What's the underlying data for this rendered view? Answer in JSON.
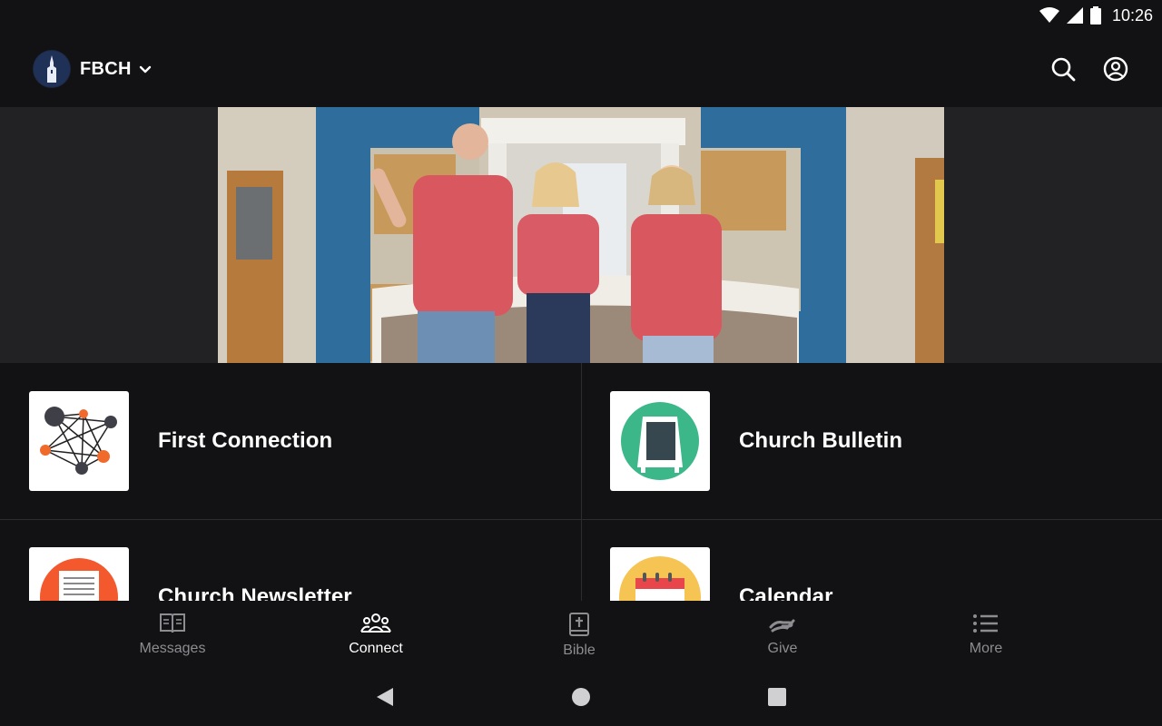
{
  "status_bar": {
    "time": "10:26",
    "icons": [
      "wifi-icon",
      "signal-icon",
      "battery-icon"
    ]
  },
  "app_bar": {
    "title": "FBCH",
    "icons": {
      "logo": "church-steeple-logo",
      "dropdown": "chevron-down-icon",
      "search": "search-icon",
      "profile": "account-circle-icon"
    }
  },
  "hero": {
    "description_icon": "welcome-photo"
  },
  "tiles": [
    {
      "label": "First Connection",
      "icon": "network-graph-icon"
    },
    {
      "label": "Church Bulletin",
      "icon": "bulletin-board-icon"
    },
    {
      "label": "Church Newsletter",
      "icon": "newsletter-icon"
    },
    {
      "label": "Calendar",
      "icon": "calendar-icon"
    }
  ],
  "bottom_nav": {
    "items": [
      {
        "label": "Messages",
        "icon": "open-book-icon"
      },
      {
        "label": "Connect",
        "icon": "people-group-icon"
      },
      {
        "label": "Bible",
        "icon": "bible-icon"
      },
      {
        "label": "Give",
        "icon": "giving-hand-icon"
      },
      {
        "label": "More",
        "icon": "list-icon"
      }
    ],
    "active": "Connect"
  },
  "system_nav": {
    "icons": [
      "back-icon",
      "home-icon",
      "recents-icon"
    ]
  },
  "colors": {
    "background": "#121214",
    "active_nav": "#ffffff",
    "inactive_nav": "#8d8d91",
    "accent_blue": "#2f6d9c",
    "shirt_red": "#d9575e"
  }
}
